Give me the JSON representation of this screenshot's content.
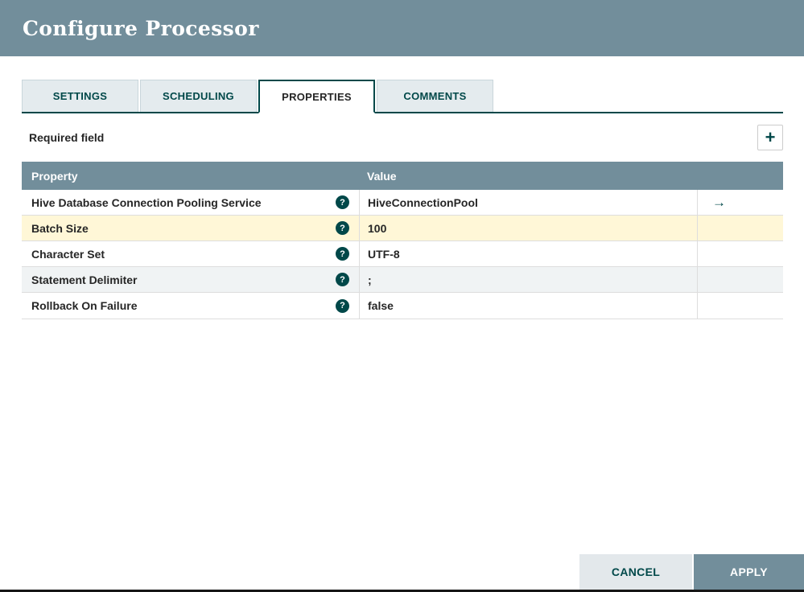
{
  "colors": {
    "header_bg": "#728E9B",
    "accent_teal": "#004849",
    "tab_inactive_bg": "#E4EBEE",
    "selected_row_bg": "#FFF7D7",
    "alt_row_bg": "#F0F3F4",
    "apply_button_bg": "#728E9B",
    "cancel_button_bg": "#E3E8EB",
    "table_header_bg": "#728E9B",
    "border_light": "#DDDDDD"
  },
  "dialog": {
    "title": "Configure Processor"
  },
  "tabs": [
    {
      "label": "SETTINGS"
    },
    {
      "label": "SCHEDULING"
    },
    {
      "label": "PROPERTIES"
    },
    {
      "label": "COMMENTS"
    }
  ],
  "toolbar": {
    "required_field_label": "Required field"
  },
  "icons": {
    "add": "+",
    "help": "?",
    "goto_arrow": "→"
  },
  "table": {
    "headers": {
      "property": "Property",
      "value": "Value"
    },
    "rows": [
      {
        "property": "Hive Database Connection Pooling Service",
        "value": "HiveConnectionPool"
      },
      {
        "property": "Batch Size",
        "value": "100"
      },
      {
        "property": "Character Set",
        "value": "UTF-8"
      },
      {
        "property": "Statement Delimiter",
        "value": ";"
      },
      {
        "property": "Rollback On Failure",
        "value": "false"
      }
    ]
  },
  "footer": {
    "cancel_label": "CANCEL",
    "apply_label": "APPLY"
  }
}
